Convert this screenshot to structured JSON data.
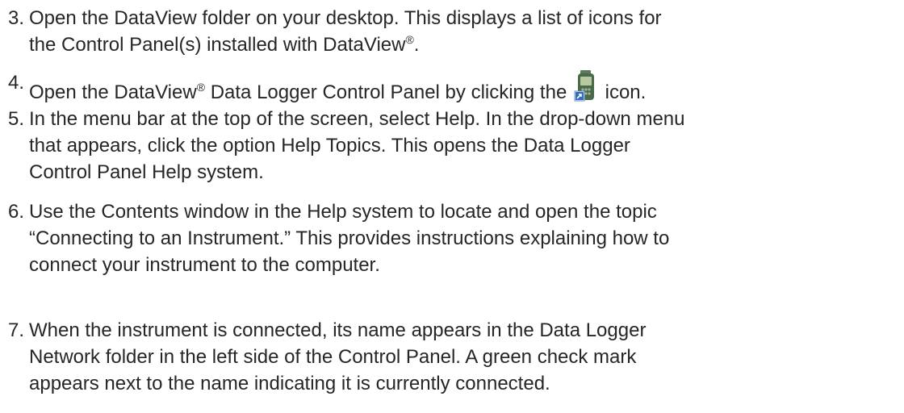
{
  "steps": [
    {
      "number": "3.",
      "lines": [
        "Open the DataView folder on your desktop. This displays a list of icons for",
        "the Control Panel(s) installed with DataView",
        "."
      ],
      "reg": "®"
    },
    {
      "number": "4.",
      "parts": [
        "Open the DataView",
        "®",
        " Data Logger Control Panel by clicking the ",
        " icon."
      ],
      "icon": "data-logger-control-panel-icon"
    },
    {
      "number": "5.",
      "lines": [
        "In the menu bar at the top of the screen, select Help. In the drop-down menu",
        "that appears, click the option Help Topics. This opens the Data Logger",
        "Control Panel Help system."
      ]
    },
    {
      "number": "6.",
      "lines": [
        "Use the Contents window in the Help system to locate and open the topic",
        "“Connecting to an Instrument.” This provides instructions explaining how to",
        "connect your instrument to the computer."
      ]
    },
    {
      "number": "7.",
      "lines": [
        "When the instrument is connected, its name appears in the Data Logger",
        "Network folder in the left side of the Control Panel. A green check mark",
        "appears next to the name indicating it is currently connected."
      ]
    }
  ],
  "colors": {
    "text": "#262626",
    "icon_body": "#4a6a4a",
    "icon_screen": "#b8c8a0",
    "icon_arrow_bg": "#2f6fc0"
  }
}
